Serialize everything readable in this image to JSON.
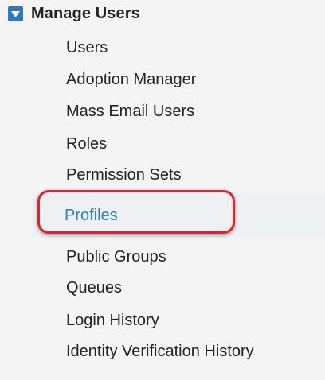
{
  "section": {
    "title": "Manage Users",
    "toggle_icon": "triangle-down-icon",
    "toggle_color": "#2d79bb"
  },
  "nav": {
    "items": [
      {
        "label": "Users"
      },
      {
        "label": "Adoption Manager"
      },
      {
        "label": "Mass Email Users"
      },
      {
        "label": "Roles"
      },
      {
        "label": "Permission Sets"
      },
      {
        "label": "Profiles",
        "selected": true
      },
      {
        "label": "Public Groups"
      },
      {
        "label": "Queues"
      },
      {
        "label": "Login History"
      },
      {
        "label": "Identity Verification History"
      }
    ]
  },
  "colors": {
    "selected_link": "#2f7fc1",
    "highlight_ring": "#e5202a",
    "background": "#f4f4f4"
  }
}
